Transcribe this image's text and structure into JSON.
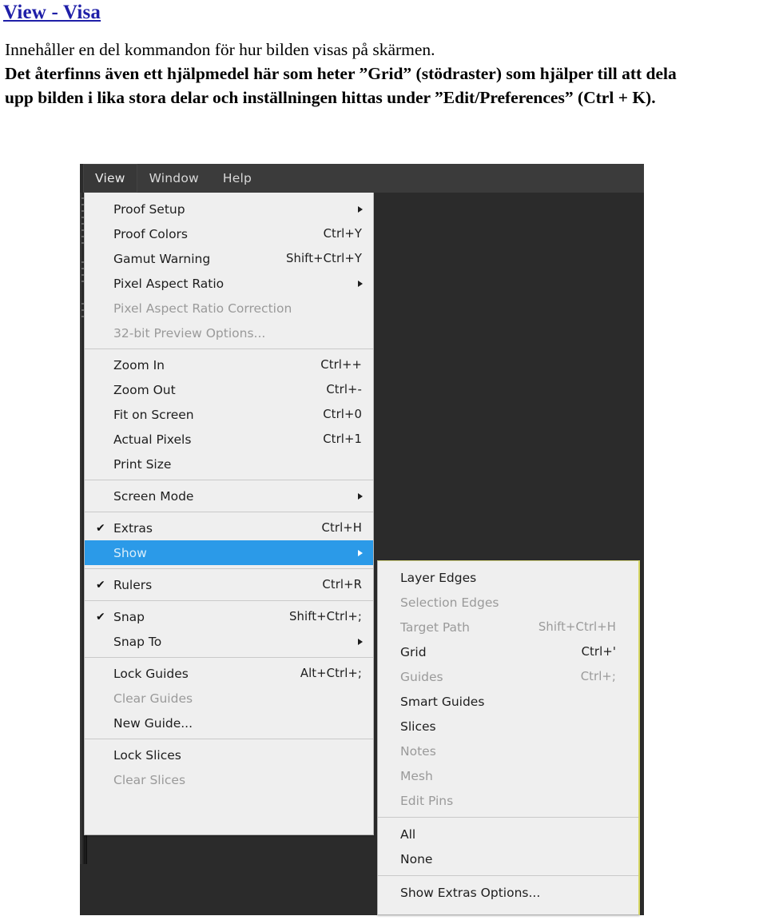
{
  "document": {
    "heading": "View  - Visa",
    "paragraph_lines": [
      "Innehåller en del kommandon för hur bilden visas på skärmen.",
      "Det återfinns även ett hjälpmedel här som heter ”Grid” (stödraster) som hjälper till att dela",
      "upp bilden i lika stora delar och inställningen hittas under ”Edit/Preferences” (Ctrl + K)."
    ]
  },
  "colors": {
    "heading": "#1f1fa8",
    "menu_background": "#efefef",
    "menubar_background": "#3b3b3b",
    "canvas": "#2b2b2b",
    "highlight": "#2b9ae8",
    "disabled_text": "#9a9a9a",
    "submenu_border": "#d7d764"
  },
  "menubar": {
    "items": [
      {
        "label": "View",
        "active": true
      },
      {
        "label": "Window",
        "active": false
      },
      {
        "label": "Help",
        "active": false
      }
    ]
  },
  "view_menu": {
    "groups": [
      {
        "items": [
          {
            "label": "Proof Setup",
            "accel": "",
            "submenu": true,
            "checked": false,
            "disabled": false
          },
          {
            "label": "Proof Colors",
            "accel": "Ctrl+Y",
            "submenu": false,
            "checked": false,
            "disabled": false
          },
          {
            "label": "Gamut Warning",
            "accel": "Shift+Ctrl+Y",
            "submenu": false,
            "checked": false,
            "disabled": false
          },
          {
            "label": "Pixel Aspect Ratio",
            "accel": "",
            "submenu": true,
            "checked": false,
            "disabled": false
          },
          {
            "label": "Pixel Aspect Ratio Correction",
            "accel": "",
            "submenu": false,
            "checked": false,
            "disabled": true
          },
          {
            "label": "32-bit Preview Options...",
            "accel": "",
            "submenu": false,
            "checked": false,
            "disabled": true
          }
        ]
      },
      {
        "items": [
          {
            "label": "Zoom In",
            "accel": "Ctrl++",
            "submenu": false,
            "checked": false,
            "disabled": false
          },
          {
            "label": "Zoom Out",
            "accel": "Ctrl+-",
            "submenu": false,
            "checked": false,
            "disabled": false
          },
          {
            "label": "Fit on Screen",
            "accel": "Ctrl+0",
            "submenu": false,
            "checked": false,
            "disabled": false
          },
          {
            "label": "Actual Pixels",
            "accel": "Ctrl+1",
            "submenu": false,
            "checked": false,
            "disabled": false
          },
          {
            "label": "Print Size",
            "accel": "",
            "submenu": false,
            "checked": false,
            "disabled": false
          }
        ]
      },
      {
        "items": [
          {
            "label": "Screen Mode",
            "accel": "",
            "submenu": true,
            "checked": false,
            "disabled": false
          }
        ]
      },
      {
        "items": [
          {
            "label": "Extras",
            "accel": "Ctrl+H",
            "submenu": false,
            "checked": true,
            "disabled": false
          },
          {
            "label": "Show",
            "accel": "",
            "submenu": true,
            "checked": false,
            "disabled": false,
            "selected": true
          }
        ]
      },
      {
        "items": [
          {
            "label": "Rulers",
            "accel": "Ctrl+R",
            "submenu": false,
            "checked": true,
            "disabled": false
          }
        ]
      },
      {
        "items": [
          {
            "label": "Snap",
            "accel": "Shift+Ctrl+;",
            "submenu": false,
            "checked": true,
            "disabled": false
          },
          {
            "label": "Snap To",
            "accel": "",
            "submenu": true,
            "checked": false,
            "disabled": false
          }
        ]
      },
      {
        "items": [
          {
            "label": "Lock Guides",
            "accel": "Alt+Ctrl+;",
            "submenu": false,
            "checked": false,
            "disabled": false
          },
          {
            "label": "Clear Guides",
            "accel": "",
            "submenu": false,
            "checked": false,
            "disabled": true
          },
          {
            "label": "New Guide...",
            "accel": "",
            "submenu": false,
            "checked": false,
            "disabled": false
          }
        ]
      },
      {
        "items": [
          {
            "label": "Lock Slices",
            "accel": "",
            "submenu": false,
            "checked": false,
            "disabled": false
          },
          {
            "label": "Clear Slices",
            "accel": "",
            "submenu": false,
            "checked": false,
            "disabled": true
          }
        ]
      }
    ]
  },
  "show_submenu": {
    "groups": [
      {
        "items": [
          {
            "label": "Layer Edges",
            "accel": "",
            "disabled": false
          },
          {
            "label": "Selection Edges",
            "accel": "",
            "disabled": true
          },
          {
            "label": "Target Path",
            "accel": "Shift+Ctrl+H",
            "disabled": true
          },
          {
            "label": "Grid",
            "accel": "Ctrl+'",
            "disabled": false
          },
          {
            "label": "Guides",
            "accel": "Ctrl+;",
            "disabled": true
          },
          {
            "label": "Smart Guides",
            "accel": "",
            "disabled": false
          },
          {
            "label": "Slices",
            "accel": "",
            "disabled": false
          },
          {
            "label": "Notes",
            "accel": "",
            "disabled": true
          },
          {
            "label": "Mesh",
            "accel": "",
            "disabled": true
          },
          {
            "label": "Edit Pins",
            "accel": "",
            "disabled": true
          }
        ]
      },
      {
        "items": [
          {
            "label": "All",
            "accel": "",
            "disabled": false
          },
          {
            "label": "None",
            "accel": "",
            "disabled": false
          }
        ]
      },
      {
        "items": [
          {
            "label": "Show Extras Options...",
            "accel": "",
            "disabled": false
          }
        ]
      }
    ]
  }
}
